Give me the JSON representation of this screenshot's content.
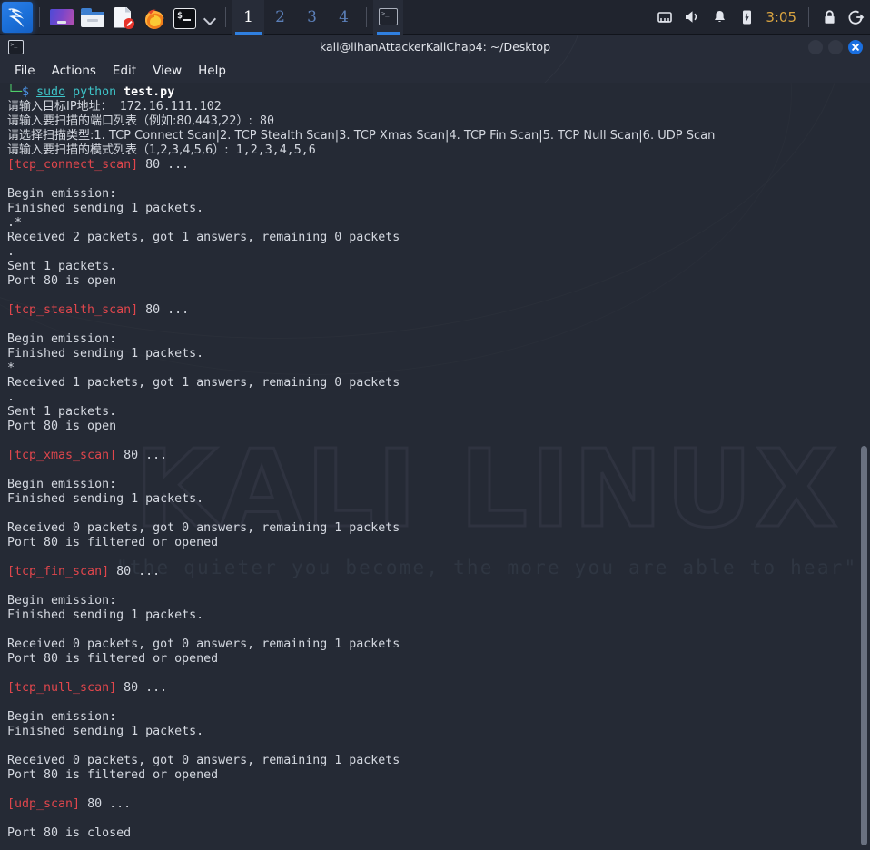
{
  "taskbar": {
    "app_launcher": "kali-dragon-logo",
    "quick_launch": [
      {
        "name": "vm-manager-icon",
        "label": "Virtual Machine Manager"
      },
      {
        "name": "file-manager-icon",
        "label": "File Manager"
      },
      {
        "name": "text-editor-icon",
        "label": "Text Editor"
      },
      {
        "name": "firefox-icon",
        "label": "Firefox ESR"
      },
      {
        "name": "terminal-icon",
        "label": "Terminal Emulator"
      }
    ],
    "show_more_icon": "chevron-down-icon",
    "workspaces": [
      {
        "label": "1",
        "active": true
      },
      {
        "label": "2",
        "active": false
      },
      {
        "label": "3",
        "active": false
      },
      {
        "label": "4",
        "active": false
      }
    ],
    "window_buttons": [
      {
        "name": "taskbar-window-terminal",
        "icon": "terminal-icon",
        "active": true
      }
    ],
    "tray": [
      {
        "name": "network-icon"
      },
      {
        "name": "volume-icon"
      },
      {
        "name": "notifications-bell-icon"
      },
      {
        "name": "battery-icon"
      }
    ],
    "clock": "3:05",
    "session": [
      {
        "name": "lock-screen-icon"
      },
      {
        "name": "logout-icon"
      }
    ]
  },
  "window": {
    "app_icon": "terminal-icon",
    "title": "kali@lihanAttackerKaliChap4: ~/Desktop",
    "controls": [
      {
        "name": "minimize-button"
      },
      {
        "name": "maximize-button"
      },
      {
        "name": "close-button"
      }
    ],
    "menus": [
      "File",
      "Actions",
      "Edit",
      "View",
      "Help"
    ]
  },
  "watermark": {
    "brand": "KALI LINUX",
    "tagline": "\"the quieter you become, the more you are able to hear\""
  },
  "terminal": {
    "prompt": {
      "branch": "└─",
      "sigil": "$",
      "sudo": "sudo",
      "interpreter": "python",
      "script": "test.py"
    },
    "prompts": {
      "ip_label": "请输入目标IP地址：",
      "ip_value": "172.16.111.102",
      "ports_label": "请输入要扫描的端口列表（例如:80,443,22）:",
      "ports_value": "80",
      "type_label": "请选择扫描类型:1. TCP Connect Scan|2. TCP Stealth Scan|3. TCP Xmas Scan|4. TCP Fin Scan|5. TCP Null Scan|6. UDP Scan",
      "modes_label": "请输入要扫描的模式列表（1,2,3,4,5,6）:",
      "modes_value": "1,2,3,4,5,6"
    },
    "scans": [
      {
        "tag": "[tcp_connect_scan]",
        "port": "80 ...",
        "lines": [
          "",
          "Begin emission:",
          "Finished sending 1 packets.",
          ".*",
          "Received 2 packets, got 1 answers, remaining 0 packets",
          ".",
          "Sent 1 packets.",
          "Port 80 is open"
        ]
      },
      {
        "tag": "[tcp_stealth_scan]",
        "port": "80 ...",
        "lines": [
          "",
          "Begin emission:",
          "Finished sending 1 packets.",
          "*",
          "Received 1 packets, got 1 answers, remaining 0 packets",
          ".",
          "Sent 1 packets.",
          "Port 80 is open"
        ]
      },
      {
        "tag": "[tcp_xmas_scan]",
        "port": "80 ...",
        "lines": [
          "",
          "Begin emission:",
          "Finished sending 1 packets.",
          "",
          "Received 0 packets, got 0 answers, remaining 1 packets",
          "Port 80 is filtered or opened"
        ]
      },
      {
        "tag": "[tcp_fin_scan]",
        "port": "80 ...",
        "lines": [
          "",
          "Begin emission:",
          "Finished sending 1 packets.",
          "",
          "Received 0 packets, got 0 answers, remaining 1 packets",
          "Port 80 is filtered or opened"
        ]
      },
      {
        "tag": "[tcp_null_scan]",
        "port": "80 ...",
        "lines": [
          "",
          "Begin emission:",
          "Finished sending 1 packets.",
          "",
          "Received 0 packets, got 0 answers, remaining 1 packets",
          "Port 80 is filtered or opened"
        ]
      },
      {
        "tag": "[udp_scan]",
        "port": "80 ...",
        "lines": [
          "",
          "Port 80 is closed"
        ]
      }
    ]
  },
  "colors": {
    "accent_blue": "#2f7fe0",
    "terminal_bg": "#252a35",
    "chrome_bg": "#272c38",
    "taskbar_bg": "#20242e",
    "scan_tag_red": "#e0464c",
    "prompt_green": "#4fd06a",
    "prompt_cyan": "#3ec5c9",
    "clock_orange": "#d9a441"
  }
}
